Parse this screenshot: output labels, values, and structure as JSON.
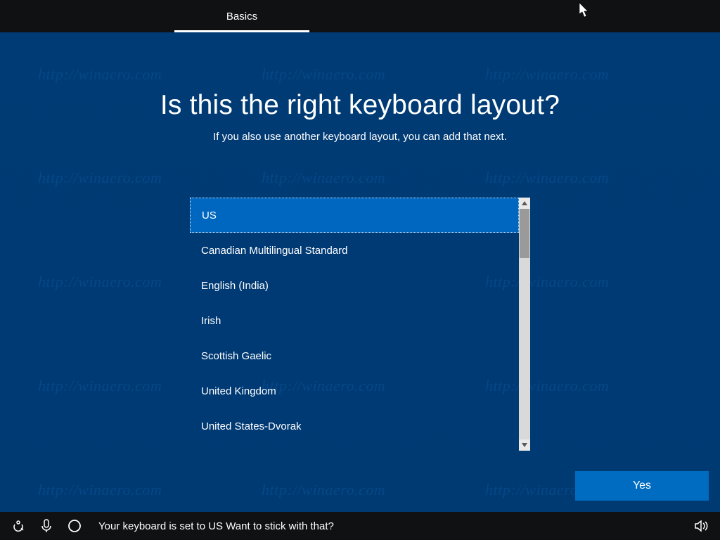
{
  "tabs": {
    "current": "Basics"
  },
  "heading": "Is this the right keyboard layout?",
  "subheading": "If you also use another keyboard layout, you can add that next.",
  "layouts": [
    {
      "label": "US",
      "selected": true
    },
    {
      "label": "Canadian Multilingual Standard",
      "selected": false
    },
    {
      "label": "English (India)",
      "selected": false
    },
    {
      "label": "Irish",
      "selected": false
    },
    {
      "label": "Scottish Gaelic",
      "selected": false
    },
    {
      "label": "United Kingdom",
      "selected": false
    },
    {
      "label": "United States-Dvorak",
      "selected": false
    }
  ],
  "primary_button": "Yes",
  "taskbar": {
    "status": "Your keyboard is set to US Want to stick with that?"
  },
  "watermark": {
    "text": "http://winaero.com"
  },
  "colors": {
    "background": "#003a73",
    "accent": "#006cc1",
    "selected": "#0067c0",
    "topbar": "#101113",
    "taskbar": "#101113"
  }
}
